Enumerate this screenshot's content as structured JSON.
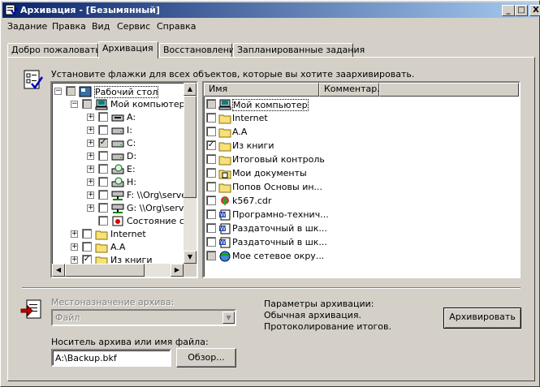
{
  "window": {
    "title": "Архивация - [Безымянный]"
  },
  "title_buttons": [
    "_",
    "□",
    "X"
  ],
  "menu": [
    "Задание",
    "Правка",
    "Вид",
    "Сервис",
    "Справка"
  ],
  "tabs": [
    {
      "label": "Добро пожаловать!"
    },
    {
      "label": "Архивация"
    },
    {
      "label": "Восстановление"
    },
    {
      "label": "Запланированные задания"
    }
  ],
  "hint": "Установите флажки для всех объектов, которые вы хотите заархивировать.",
  "tree": [
    {
      "label": "Рабочий стол",
      "check": "gray",
      "expander": "minus",
      "icon": "desktop-icon"
    },
    {
      "label": "Мой компьютер",
      "check": "gray",
      "expander": "minus",
      "icon": "computer-icon"
    },
    {
      "label": "A:",
      "check": "none",
      "expander": "plus",
      "icon": "floppy-drive-icon"
    },
    {
      "label": "I:",
      "check": "none",
      "expander": "plus",
      "icon": "drive-icon"
    },
    {
      "label": "C:",
      "check": "checked-gray",
      "expander": "plus",
      "icon": "drive-icon"
    },
    {
      "label": "D:",
      "check": "none",
      "expander": "plus",
      "icon": "drive-icon"
    },
    {
      "label": "E:",
      "check": "none",
      "expander": "plus",
      "icon": "cd-drive-icon"
    },
    {
      "label": "H:",
      "check": "none",
      "expander": "plus",
      "icon": "cd-drive-icon"
    },
    {
      "label": "F: \\\\Org\\server",
      "check": "none",
      "expander": "plus",
      "icon": "network-drive-icon"
    },
    {
      "label": "G: \\\\Org\\server",
      "check": "none",
      "expander": "plus",
      "icon": "network-drive-icon"
    },
    {
      "label": "Состояние системы",
      "check": "none",
      "expander": "none",
      "icon": "system-state-icon"
    },
    {
      "label": "Internet",
      "check": "none",
      "expander": "plus",
      "icon": "folder-icon"
    },
    {
      "label": "A.A",
      "check": "none",
      "expander": "plus",
      "icon": "folder-icon"
    },
    {
      "label": "Из книги",
      "check": "checked",
      "expander": "plus",
      "icon": "folder-icon"
    }
  ],
  "list_headers": [
    "Имя",
    "Комментар..."
  ],
  "list": [
    {
      "label": "Мой компьютер",
      "check": "gray",
      "icon": "computer-icon"
    },
    {
      "label": "Internet",
      "check": "none",
      "icon": "folder-icon"
    },
    {
      "label": "A.A",
      "check": "none",
      "icon": "folder-icon"
    },
    {
      "label": "Из книги",
      "check": "checked",
      "icon": "folder-icon"
    },
    {
      "label": "Итоговый контроль",
      "check": "none",
      "icon": "folder-icon"
    },
    {
      "label": "Мои документы",
      "check": "none",
      "icon": "my-documents-icon"
    },
    {
      "label": "Попов Основы ин...",
      "check": "none",
      "icon": "folder-icon"
    },
    {
      "label": "k567.cdr",
      "check": "none",
      "icon": "coreldraw-file-icon"
    },
    {
      "label": "Програмно-технич...",
      "check": "none",
      "icon": "word-document-icon"
    },
    {
      "label": "Раздаточный в шк...",
      "check": "none",
      "icon": "word-document-icon"
    },
    {
      "label": "Раздаточный в шк...",
      "check": "none",
      "icon": "word-document-icon"
    },
    {
      "label": "Мое сетевое окру...",
      "check": "gray",
      "icon": "network-places-icon"
    }
  ],
  "destination": {
    "label": "Местоназначение архива:",
    "value": "Файл"
  },
  "media": {
    "label": "Носитель архива или имя файла:",
    "value": "A:\\Backup.bkf"
  },
  "browse_label": "Обзор...",
  "params": {
    "title": "Параметры архивации:",
    "line1": "Обычная архивация.",
    "line2": "Протоколирование итогов."
  },
  "archive_label": "Архивировать"
}
